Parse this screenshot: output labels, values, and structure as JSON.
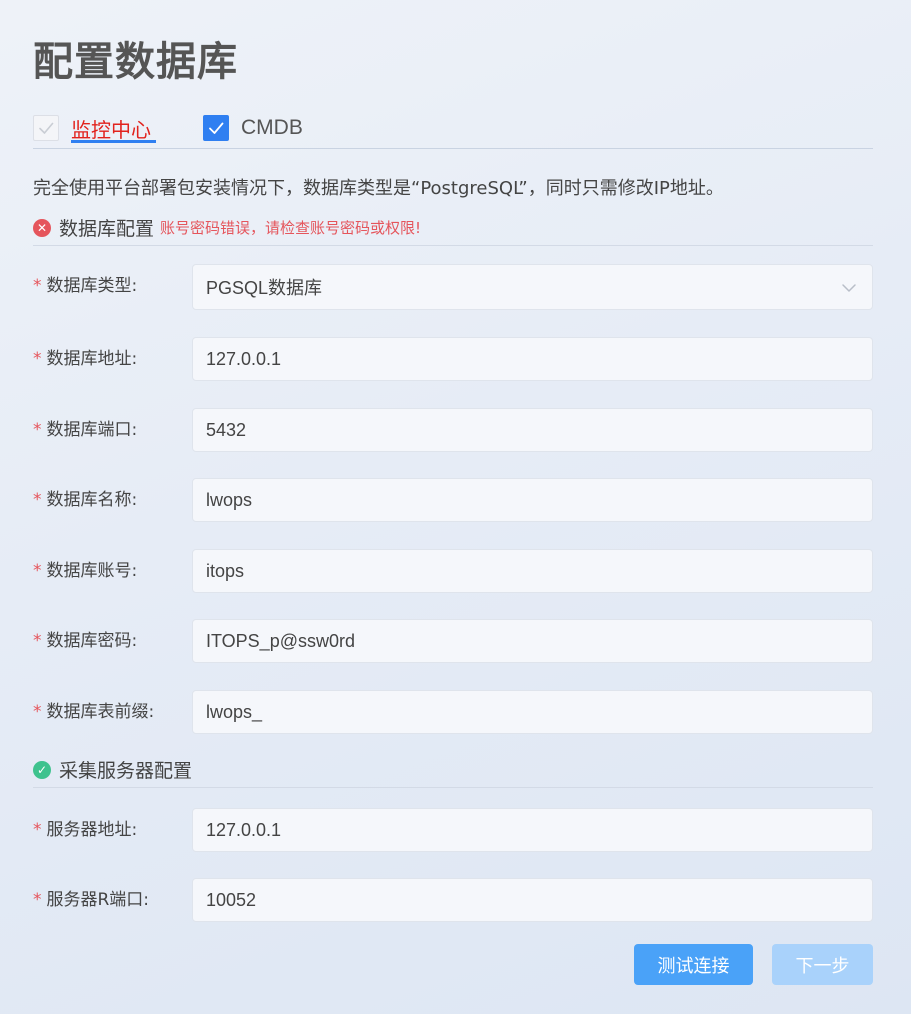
{
  "page": {
    "title": "配置数据库"
  },
  "tabs": [
    {
      "label": "监控中心",
      "checked": false,
      "active": true
    },
    {
      "label": "CMDB",
      "checked": true,
      "active": false
    }
  ],
  "notice": "完全使用平台部署包安装情况下，数据库类型是“PostgreSQL”，同时只需修改IP地址。",
  "db_section": {
    "title": "数据库配置",
    "status": "error",
    "error": "账号密码错误，请检查账号密码或权限!"
  },
  "db_fields": {
    "type": {
      "label": "数据库类型:",
      "value": "PGSQL数据库"
    },
    "address": {
      "label": "数据库地址:",
      "value": "127.0.0.1"
    },
    "port": {
      "label": "数据库端口:",
      "value": "5432"
    },
    "name": {
      "label": "数据库名称:",
      "value": "lwops"
    },
    "account": {
      "label": "数据库账号:",
      "value": "itops"
    },
    "password": {
      "label": "数据库密码:",
      "value": "ITOPS_p@ssw0rd"
    },
    "prefix": {
      "label": "数据库表前缀:",
      "value": "lwops_"
    }
  },
  "srv_section": {
    "title": "采集服务器配置",
    "status": "ok"
  },
  "srv_fields": {
    "address": {
      "label": "服务器地址:",
      "value": "127.0.0.1"
    },
    "port": {
      "label": "服务器R端口:",
      "value": "10052"
    }
  },
  "buttons": {
    "test": "测试连接",
    "next": "下一步"
  },
  "colors": {
    "primary": "#2f7ff1",
    "error": "#e5555c",
    "success": "#3ec28e",
    "tab_active_text": "#e2221d"
  }
}
